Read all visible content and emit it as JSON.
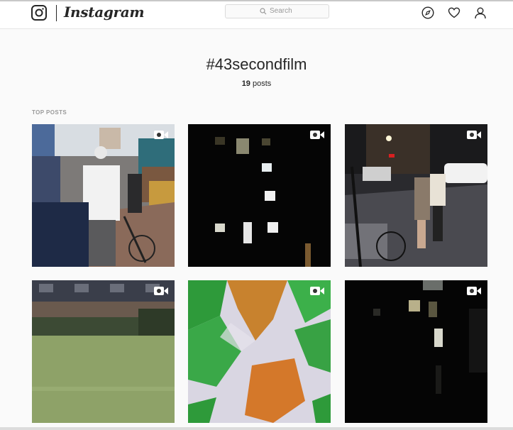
{
  "header": {
    "brand": "Instagram",
    "search_placeholder": "Search"
  },
  "hashtag": {
    "title": "#43secondfilm",
    "count": "19",
    "count_suffix": "posts"
  },
  "section": {
    "label": "TOP POSTS"
  },
  "posts": [
    {
      "type": "video",
      "subject": "street-market"
    },
    {
      "type": "video",
      "subject": "dark-building-windows"
    },
    {
      "type": "video",
      "subject": "night-street-couple"
    },
    {
      "type": "video",
      "subject": "green-canal"
    },
    {
      "type": "video",
      "subject": "crumpled-colored-paper"
    },
    {
      "type": "video",
      "subject": "dark-alley-building"
    }
  ],
  "colors": {
    "background": "#fafafa",
    "header_bg": "#ffffff",
    "text": "#262626",
    "muted": "#999999"
  }
}
